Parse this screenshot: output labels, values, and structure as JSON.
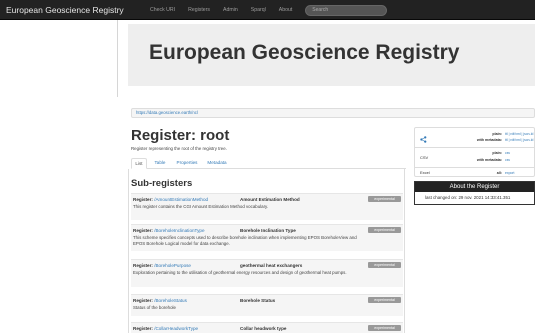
{
  "navbar": {
    "brand": "European Geoscience Registry",
    "links": [
      "Check URI",
      "Registers",
      "Admin",
      "Sparql",
      "About"
    ],
    "search_placeholder": "Search"
  },
  "jumbotron": {
    "title": "European Geoscience Registry"
  },
  "breadcrumb_url": "https://data.geoscience.earth/ncl",
  "register": {
    "title": "Register: root",
    "description": "Register representing the root of the registry tree.",
    "tabs": [
      "List",
      "Table",
      "Properties",
      "Metadata"
    ],
    "subregisters_heading": "Sub-registers"
  },
  "rows": [
    {
      "prefix": "Register:",
      "link": "/AmountEstimationMethod",
      "name": "Amount Estimation Method",
      "badge": "experimental",
      "desc": "This register contains the CGI Amount Estimation Method vocabulary."
    },
    {
      "prefix": "Register:",
      "link": "/BoreholeInclinationType",
      "name": "Borehole Inclination Type",
      "badge": "experimental",
      "desc": "This scheme specifies concepts used to describe borehole inclination when implementing EPOS BoreholeView and EPOS Borehole Logical model for data exchange."
    },
    {
      "prefix": "Register:",
      "link": "/BoreholePurpose",
      "name": "geothermal heat exchangers",
      "badge": "experimental",
      "desc": "Exploration pertaining to the utilisation of geothermal energy resources and design of geothermal heat pumps."
    },
    {
      "prefix": "Register:",
      "link": "/BoreholeStatus",
      "name": "Borehole Status",
      "badge": "experimental",
      "desc": "Status of the borehole"
    },
    {
      "prefix": "Register:",
      "link": "/CollarHeadworkType",
      "name": "Collar headwork type",
      "badge": "experimental",
      "desc": ""
    }
  ],
  "formats": {
    "plain_key": "plain:",
    "plain_val": "ttl | rdf/xml | json-ld",
    "meta_key": "with metadata:",
    "meta_val": "ttl | rdf/xml | json-ld",
    "csv_label": "CSV",
    "csv_plain_key": "plain:",
    "csv_plain_val": "csv",
    "csv_meta_key": "with metadata:",
    "csv_meta_val": "csv",
    "excel_label": "Excel",
    "excel_key": "all:",
    "excel_val": "export"
  },
  "about": {
    "heading": "About the Register",
    "last_changed": "last changed on: 29 nov. 2021 14:33:41.351"
  }
}
